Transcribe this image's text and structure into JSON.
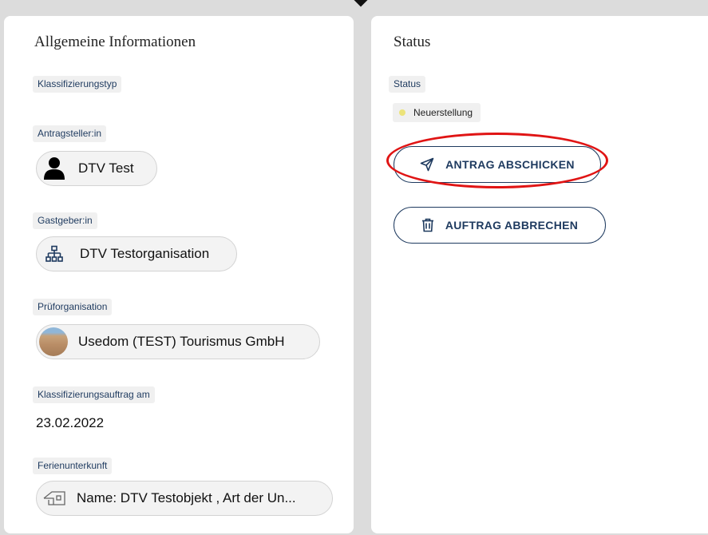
{
  "general": {
    "title": "Allgemeine Informationen",
    "classification_type_label": "Klassifizierungstyp",
    "applicant_label": "Antragsteller:in",
    "applicant_name": "DTV Test",
    "host_label": "Gastgeber:in",
    "host_name": "DTV Testorganisation",
    "inspector_label": "Prüforganisation",
    "inspector_name": "Usedom (TEST) Tourismus GmbH",
    "order_date_label": "Klassifizierungsauftrag am",
    "order_date": "23.02.2022",
    "accommodation_label": "Ferienunterkunft",
    "accommodation_name": "Name: DTV Testobjekt , Art der Un..."
  },
  "status": {
    "title": "Status",
    "label": "Status",
    "value": "Neuerstellung",
    "dot_color": "#ece37a"
  },
  "actions": {
    "submit_label": "ANTRAG ABSCHICKEN",
    "cancel_label": "AUFTRAG ABBRECHEN",
    "accent_color": "#1e3a5f",
    "highlight_color": "#e01414"
  },
  "icons": {
    "applicant": "person-icon",
    "host": "org-chart-icon",
    "inspector": "organization-avatar",
    "accommodation": "house-icon",
    "submit": "paper-plane-icon",
    "cancel": "trash-icon"
  }
}
